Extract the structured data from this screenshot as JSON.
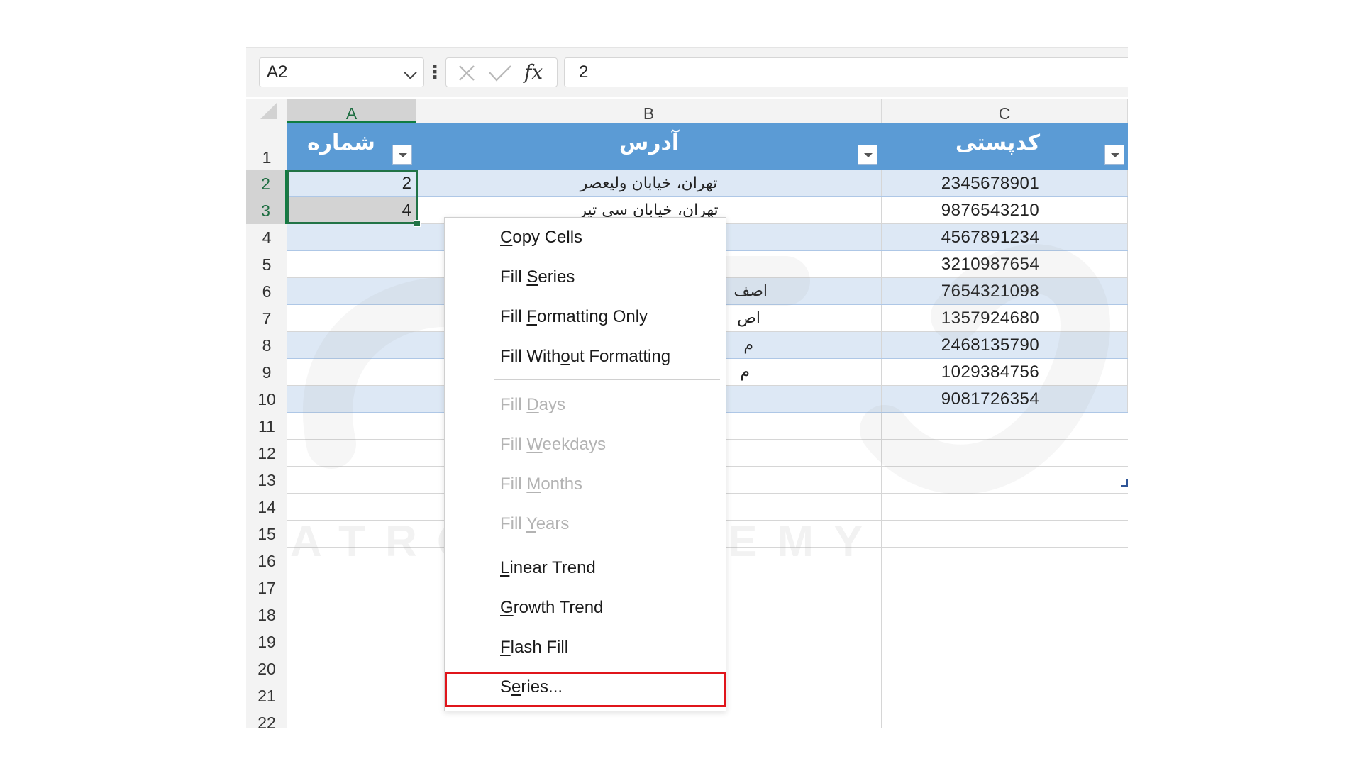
{
  "formula_bar": {
    "name_box": "A2",
    "more_options": "⋮",
    "fx_label": "fx",
    "formula_value": "2"
  },
  "columns": [
    "A",
    "B",
    "C"
  ],
  "header_row": {
    "row_number": "1",
    "col_a": "شماره",
    "col_b": "آدرس",
    "col_c": "کدپستی"
  },
  "rows": [
    {
      "num": "2",
      "a": "2",
      "b": "تهران، خیابان ولیعصر",
      "c": "2345678901"
    },
    {
      "num": "3",
      "a": "4",
      "b": "تهران، خیابان سی تیر",
      "c": "9876543210"
    },
    {
      "num": "4",
      "a": "",
      "b": "",
      "c": "4567891234"
    },
    {
      "num": "5",
      "a": "",
      "b": "",
      "c": "3210987654"
    },
    {
      "num": "6",
      "a": "",
      "b": "اصف",
      "c": "7654321098"
    },
    {
      "num": "7",
      "a": "",
      "b": "اص",
      "c": "1357924680"
    },
    {
      "num": "8",
      "a": "",
      "b": "م",
      "c": "2468135790"
    },
    {
      "num": "9",
      "a": "",
      "b": "م",
      "c": "1029384756"
    },
    {
      "num": "10",
      "a": "",
      "b": "",
      "c": "9081726354"
    }
  ],
  "empty_rows": [
    "11",
    "12",
    "13",
    "14",
    "15",
    "16",
    "17",
    "18",
    "19",
    "20",
    "21",
    "22"
  ],
  "watermark": "ATRO ACADEMY",
  "context_menu": {
    "items": [
      {
        "pre": "",
        "key": "C",
        "post": "opy Cells",
        "enabled": true
      },
      {
        "pre": "Fill ",
        "key": "S",
        "post": "eries",
        "enabled": true
      },
      {
        "pre": "Fill ",
        "key": "F",
        "post": "ormatting Only",
        "enabled": true
      },
      {
        "pre": "Fill With",
        "key": "o",
        "post": "ut Formatting",
        "enabled": true
      },
      {
        "pre": "Fill ",
        "key": "D",
        "post": "ays",
        "enabled": false
      },
      {
        "pre": "Fill ",
        "key": "W",
        "post": "eekdays",
        "enabled": false
      },
      {
        "pre": "Fill ",
        "key": "M",
        "post": "onths",
        "enabled": false
      },
      {
        "pre": "Fill ",
        "key": "Y",
        "post": "ears",
        "enabled": false
      },
      {
        "pre": "",
        "key": "L",
        "post": "inear Trend",
        "enabled": true
      },
      {
        "pre": "",
        "key": "G",
        "post": "rowth Trend",
        "enabled": true
      },
      {
        "pre": "",
        "key": "F",
        "post": "lash Fill",
        "enabled": true
      },
      {
        "pre": "S",
        "key": "e",
        "post": "ries...",
        "enabled": true
      }
    ]
  },
  "colors": {
    "table_header": "#5b9bd5",
    "band": "#dde8f5",
    "selection": "#217346",
    "highlight": "#e0151b"
  }
}
